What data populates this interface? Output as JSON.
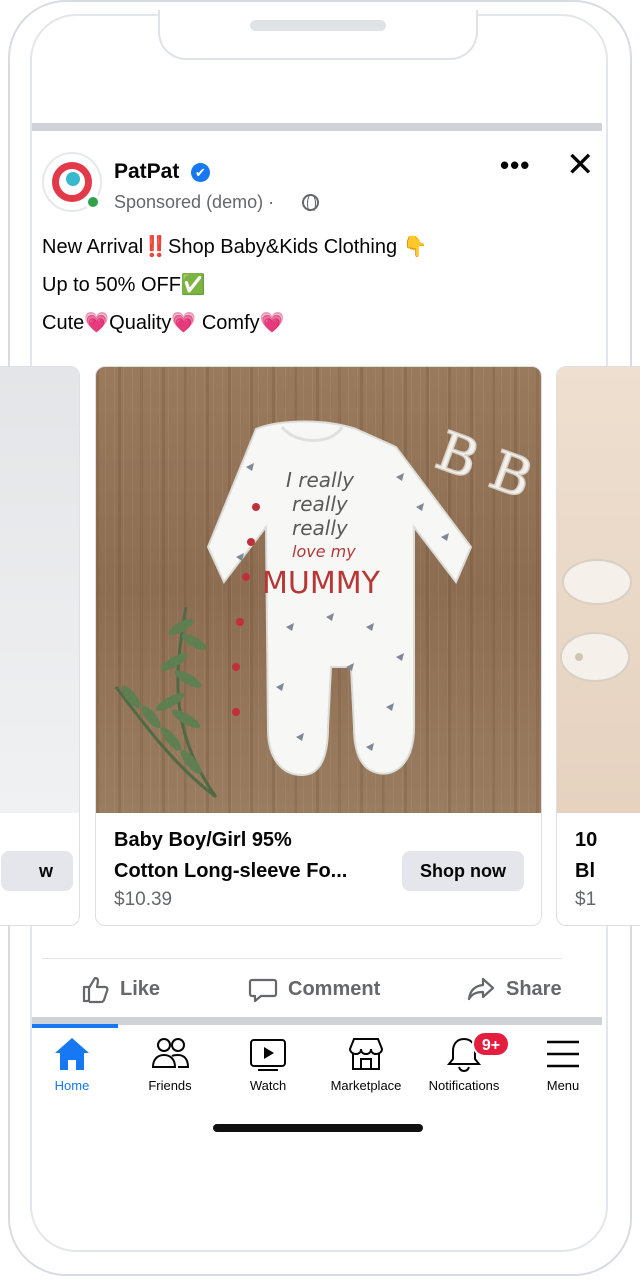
{
  "post": {
    "page_name": "PatPat",
    "verified_icon": "✔",
    "sponsored": "Sponsored (demo) ·",
    "more_label": "•••",
    "close_label": "✕",
    "caption": [
      "New Arrival‼️Shop Baby&Kids Clothing 👇",
      "Up to 50% OFF✅",
      "Cute💗Quality💗 Comfy💗"
    ]
  },
  "carousel": {
    "prev": {
      "button": "w"
    },
    "main": {
      "title_line1": "Baby Boy/Girl 95%",
      "title_line2": "Cotton Long-sleeve Fo...",
      "price": "$10.39",
      "button": "Shop now",
      "print_lines": [
        "I really",
        "really",
        "really",
        "love my",
        "MUMMY"
      ],
      "letters": "B B"
    },
    "next": {
      "title_line1": "10",
      "title_line2": "Bl",
      "price": "$1"
    }
  },
  "actions": {
    "like": "Like",
    "comment": "Comment",
    "share": "Share"
  },
  "tabs": [
    {
      "label": "Home",
      "icon": "home-icon"
    },
    {
      "label": "Friends",
      "icon": "friends-icon"
    },
    {
      "label": "Watch",
      "icon": "watch-icon"
    },
    {
      "label": "Marketplace",
      "icon": "marketplace-icon"
    },
    {
      "label": "Notifications",
      "icon": "bell-icon",
      "badge": "9+"
    },
    {
      "label": "Menu",
      "icon": "menu-icon"
    }
  ],
  "colors": {
    "accent": "#1877f2",
    "badge": "#e41e3f",
    "brand": "#e33a4a",
    "online": "#31a24c"
  }
}
